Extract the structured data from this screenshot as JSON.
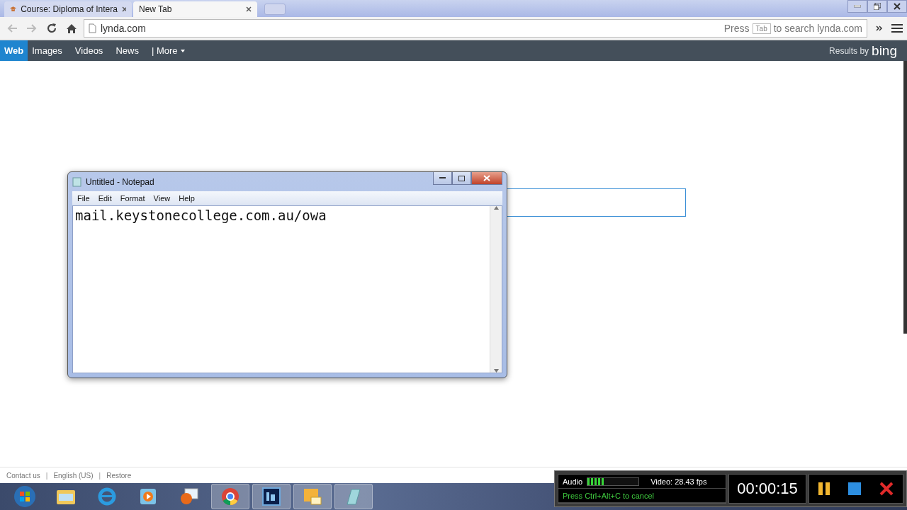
{
  "browser": {
    "tabs": [
      {
        "label": "Course: Diploma of Intera",
        "selected": false
      },
      {
        "label": "New Tab",
        "selected": true
      }
    ],
    "address": "lynda.com",
    "omnibox_hint": {
      "before": "Press",
      "key": "Tab",
      "after": "to search lynda.com"
    }
  },
  "search_nav": {
    "items": [
      {
        "label": "Web",
        "selected": true
      },
      {
        "label": "Images",
        "selected": false
      },
      {
        "label": "Videos",
        "selected": false
      },
      {
        "label": "News",
        "selected": false
      },
      {
        "label": "| More",
        "selected": false
      }
    ],
    "credit": "Results by",
    "brand": "bing"
  },
  "footer": {
    "items": [
      {
        "kind": "link",
        "text": "Contact us"
      },
      {
        "kind": "separator",
        "text": "|"
      },
      {
        "kind": "link",
        "text": "English (US)"
      },
      {
        "kind": "separator",
        "text": "|"
      },
      {
        "kind": "link",
        "text": "Restore"
      }
    ]
  },
  "notepad": {
    "title": "Untitled - Notepad",
    "menu": [
      "File",
      "Edit",
      "Format",
      "View",
      "Help"
    ],
    "text": "mail.keystonecollege.com.au/owa"
  },
  "recorder": {
    "audio_label": "Audio",
    "level": 0.35,
    "video": "Video: 28.43 fps",
    "hint": "Press Ctrl+Alt+C to cancel",
    "timer": "00:00:15"
  }
}
